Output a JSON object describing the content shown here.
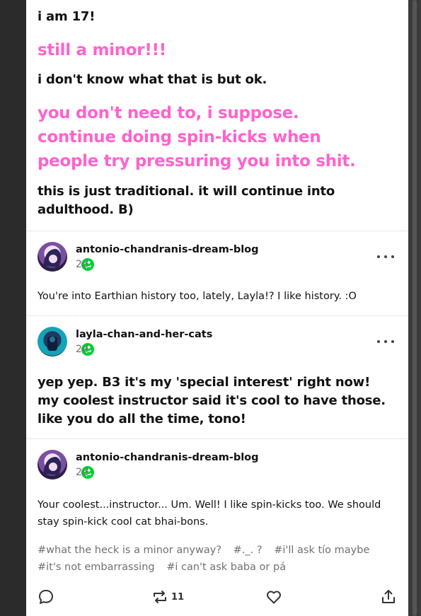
{
  "replies": [
    {
      "text": "i am 17!",
      "style": "plain"
    },
    {
      "text": "still a minor!!!",
      "style": "pink"
    },
    {
      "text": "i don't know what that is but ok.",
      "style": "plain"
    },
    {
      "text": "you don't need to, i suppose. continue doing spin-kicks when people try pressuring you into shit.",
      "style": "pink"
    },
    {
      "text": "this is just traditional. it will continue into adulthood. B)",
      "style": "plain"
    }
  ],
  "posts": [
    {
      "username": "antonio-chandranis-dream-blog",
      "time": "2d",
      "body": "You're into Earthian history too, lately, Layla!? I like history.  :O",
      "reblogged": true
    },
    {
      "username": "layla-chan-and-her-cats",
      "time": "2d",
      "body": "yep yep. B3 it's my 'special interest' right now! my coolest instructor said it's cool to have those. like you do all the time, tono!",
      "reblogged": true
    },
    {
      "username": "antonio-chandranis-dream-blog",
      "time": "2d",
      "body": "Your coolest...instructor... Um. Well! I like spin-kicks too. We should stay spin-kick cool cat bhai-bons.",
      "reblogged": true
    }
  ],
  "tags": [
    "#what the heck is a minor anyway?",
    "#._. ?",
    "#i'll ask tío maybe",
    "#it's not embarrassing",
    "#i can't ask baba or pá"
  ],
  "footer": {
    "reblog_count": "11"
  },
  "icons": {
    "reblog_badge": "reblog-icon",
    "more": "more-icon",
    "reply": "reply-icon",
    "reblog": "reblog-icon",
    "like": "heart-icon",
    "share": "share-icon"
  },
  "colors": {
    "accent_pink": "#ff62ce",
    "reblog_green": "#00cf35",
    "muted": "#707070"
  }
}
